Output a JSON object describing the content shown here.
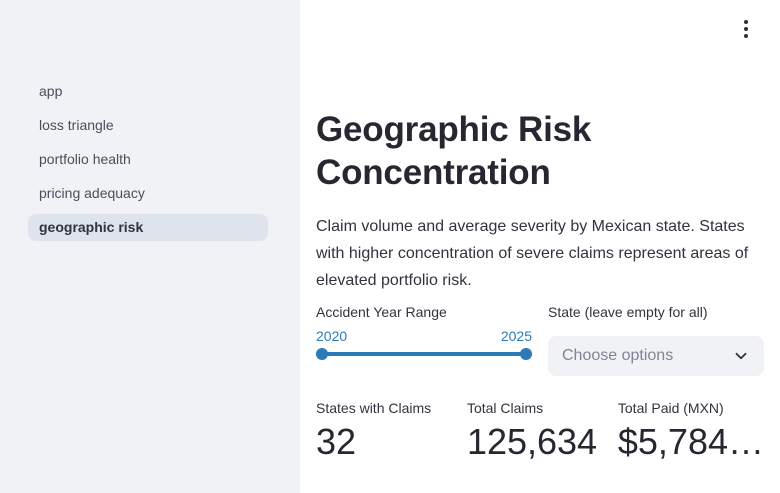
{
  "colors": {
    "accent": "#2b7bb8",
    "sidebar_bg": "#f0f2f6",
    "sidebar_active_bg": "#dfe3ec",
    "text_dark": "#262730",
    "text_body": "#31333f",
    "placeholder": "#808495"
  },
  "sidebar": {
    "items": [
      {
        "label": "app",
        "active": false
      },
      {
        "label": "loss triangle",
        "active": false
      },
      {
        "label": "portfolio health",
        "active": false
      },
      {
        "label": "pricing adequacy",
        "active": false
      },
      {
        "label": "geographic risk",
        "active": true
      }
    ]
  },
  "header": {
    "menu_icon": "kebab-menu"
  },
  "main": {
    "title": "Geographic Risk Concentration",
    "description": "Claim volume and average severity by Mexican state. States with higher concentration of severe claims represent areas of elevated portfolio risk.",
    "year_slider": {
      "label": "Accident Year Range",
      "start": "2020",
      "end": "2025"
    },
    "state_select": {
      "label": "State (leave empty for all)",
      "placeholder": "Choose options"
    },
    "metrics": [
      {
        "label": "States with Claims",
        "value": "32"
      },
      {
        "label": "Total Claims",
        "value": "125,634"
      },
      {
        "label": "Total Paid (MXN)",
        "value": "$5,784…"
      }
    ]
  }
}
